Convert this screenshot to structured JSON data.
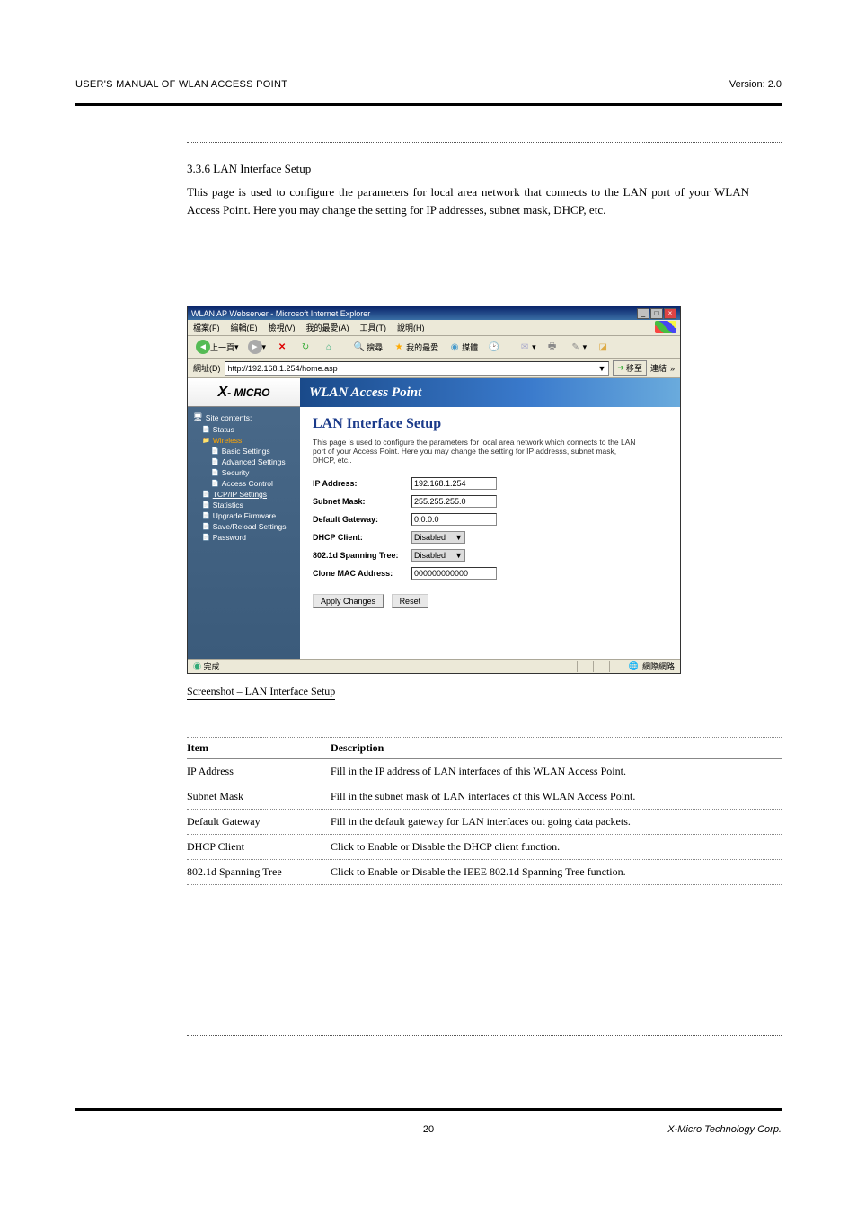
{
  "doc_header_left": "USER'S MANUAL OF WLAN ACCESS POINT",
  "doc_header_right": "Version: 2.0",
  "section_no": "3.3.6 LAN Interface Setup",
  "section_intro": "This page is used to configure the parameters for local area network that connects to the LAN port of your WLAN Access Point. Here you may change the setting for IP addresses, subnet mask, DHCP, etc.",
  "browser": {
    "title": "WLAN AP Webserver - Microsoft Internet Explorer",
    "menus": [
      "檔案(F)",
      "編輯(E)",
      "檢視(V)",
      "我的最愛(A)",
      "工具(T)",
      "說明(H)"
    ],
    "back": "上一頁",
    "toolbar": {
      "search": "搜尋",
      "favorites": "我的最愛",
      "media": "媒體"
    },
    "address_label": "網址(D)",
    "address": "http://192.168.1.254/home.asp",
    "go": "移至",
    "links": "連結",
    "status_left": "完成",
    "status_right": "網際網路"
  },
  "sidebar": {
    "logo": "X-MICRO",
    "root": "Site contents:",
    "items": {
      "status": "Status",
      "wireless": "Wireless",
      "basic": "Basic Settings",
      "advanced": "Advanced Settings",
      "security": "Security",
      "access": "Access Control",
      "tcpip": "TCP/IP Settings",
      "stats": "Statistics",
      "upgrade": "Upgrade Firmware",
      "savereload": "Save/Reload Settings",
      "password": "Password"
    }
  },
  "banner": "WLAN Access Point",
  "page": {
    "title": "LAN Interface Setup",
    "desc": "This page is used to configure the parameters for local area network which connects to the LAN port of your Access Point. Here you may change the setting for IP addresss, subnet mask, DHCP, etc..",
    "fields": {
      "ip_label": "IP Address:",
      "ip_value": "192.168.1.254",
      "subnet_label": "Subnet Mask:",
      "subnet_value": "255.255.255.0",
      "gateway_label": "Default Gateway:",
      "gateway_value": "0.0.0.0",
      "dhcp_label": "DHCP Client:",
      "dhcp_value": "Disabled",
      "spanning_label": "802.1d Spanning Tree:",
      "spanning_value": "Disabled",
      "mac_label": "Clone MAC Address:",
      "mac_value": "000000000000"
    },
    "apply": "Apply Changes",
    "reset": "Reset"
  },
  "caption": "Screenshot – LAN Interface Setup",
  "table": {
    "h1": "Item",
    "h2": "Description",
    "rows": [
      {
        "item": "IP Address",
        "desc": "Fill in the IP address of LAN interfaces of this WLAN Access Point."
      },
      {
        "item": "Subnet Mask",
        "desc": "Fill in the subnet mask of LAN interfaces of this WLAN Access Point."
      },
      {
        "item": "Default Gateway",
        "desc": "Fill in the default gateway for LAN interfaces out going data packets."
      },
      {
        "item": "DHCP Client",
        "desc": "Click to Enable or Disable the DHCP client function."
      },
      {
        "item": "802.1d Spanning Tree",
        "desc": "Click to Enable or Disable the IEEE 802.1d Spanning Tree function."
      }
    ]
  },
  "footer_right": "X-Micro Technology Corp.",
  "footer_page": "20"
}
